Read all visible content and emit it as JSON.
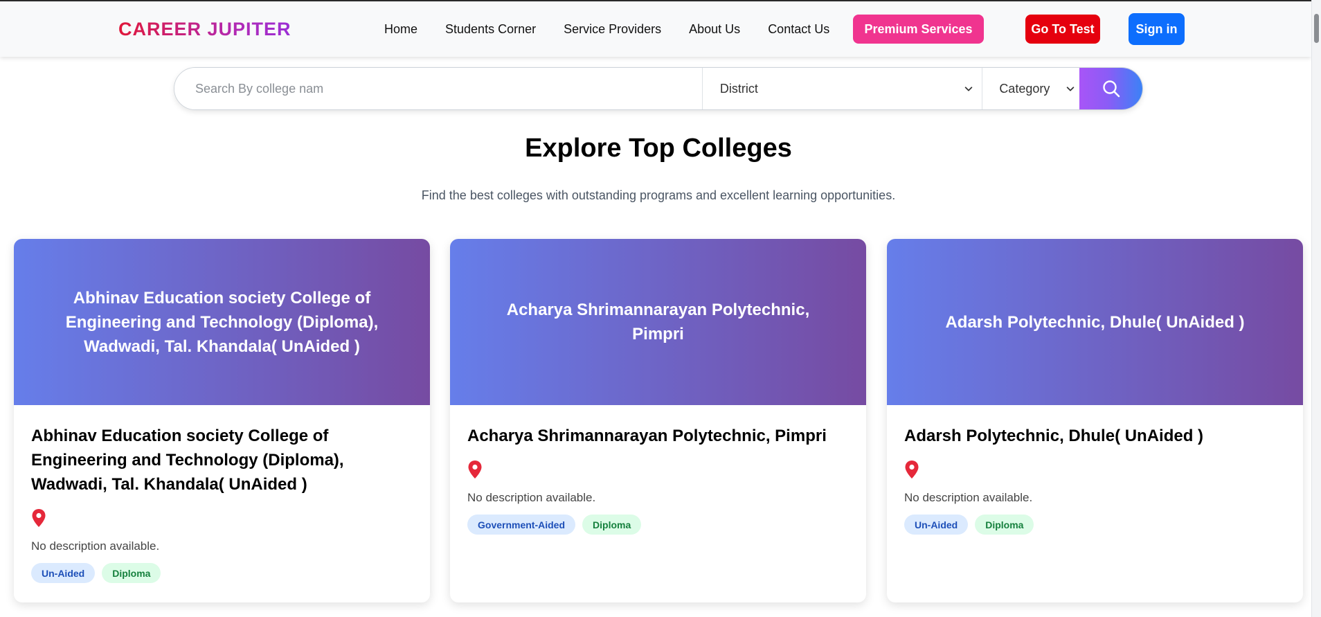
{
  "brand": "CAREER JUPITER",
  "nav": {
    "links": [
      "Home",
      "Students Corner",
      "Service Providers",
      "About Us",
      "Contact Us"
    ],
    "premium_label": "Premium Services",
    "test_label": "Go To Test",
    "signin_label": "Sign in"
  },
  "search": {
    "placeholder": "Search By college nam",
    "district_label": "District",
    "category_label": "Category"
  },
  "page": {
    "title": "Explore Top Colleges",
    "subtitle": "Find the best colleges with outstanding programs and excellent learning opportunities."
  },
  "colors": {
    "brand_start": "#e0183a",
    "brand_end": "#9b2fd6",
    "premium": "#f0348f",
    "test": "#e5000e",
    "signin": "#0d6efd",
    "card_gradient_start": "#667eea",
    "card_gradient_end": "#764ba2",
    "pin": "#e5283a"
  },
  "icons": {
    "search": "magnifier-icon",
    "location": "map-pin-icon",
    "dropdown": "chevron-down-icon"
  },
  "colleges": [
    {
      "name": "Abhinav Education society College of Engineering and Technology (Diploma), Wadwadi, Tal. Khandala( UnAided )",
      "description": "No description available.",
      "type": "Un-Aided",
      "level": "Diploma"
    },
    {
      "name": "Acharya Shrimannarayan Polytechnic, Pimpri",
      "description": "No description available.",
      "type": "Government-Aided",
      "level": "Diploma"
    },
    {
      "name": "Adarsh Polytechnic, Dhule( UnAided )",
      "description": "No description available.",
      "type": "Un-Aided",
      "level": "Diploma"
    }
  ]
}
